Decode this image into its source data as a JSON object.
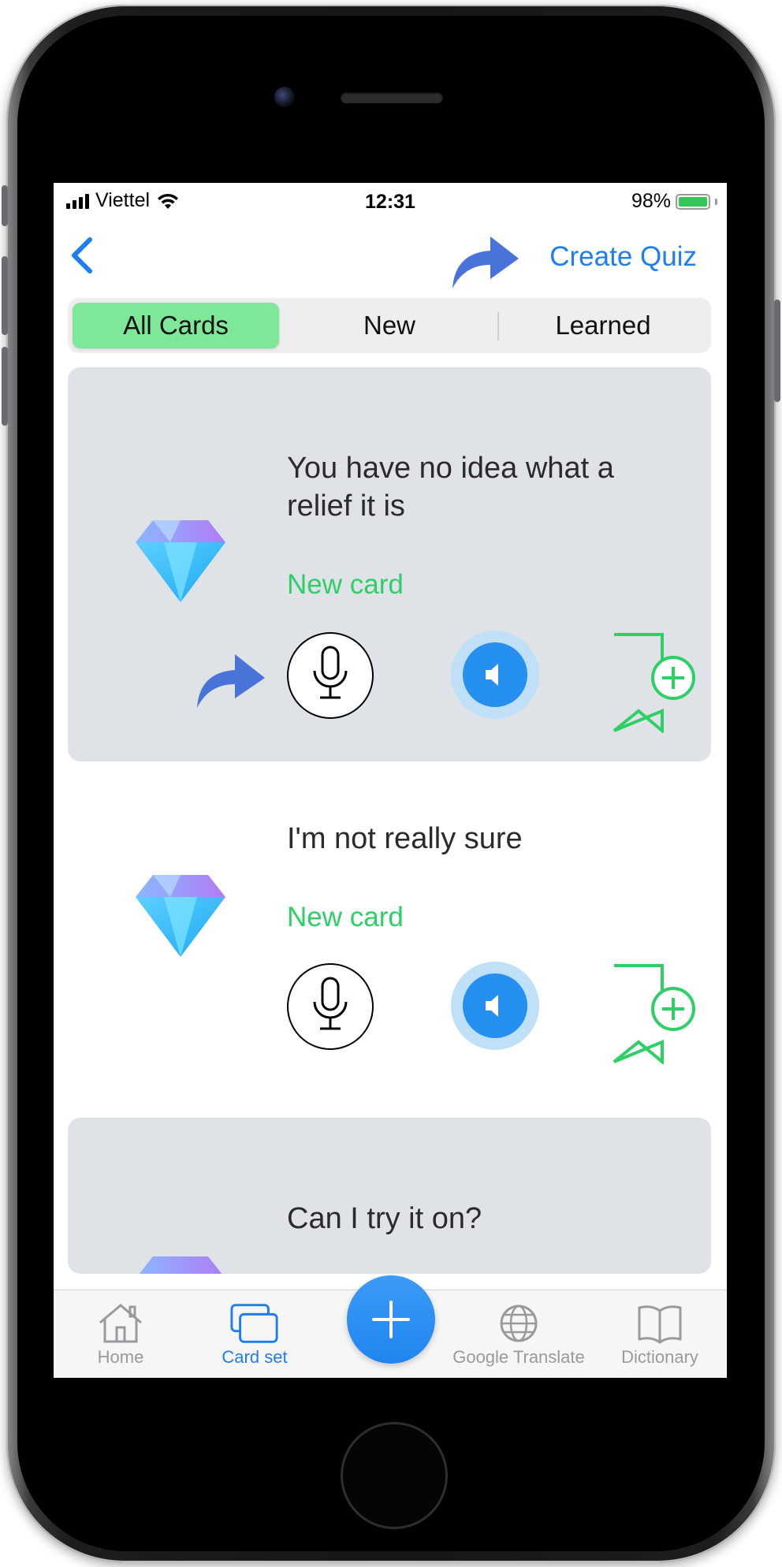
{
  "status_bar": {
    "carrier": "Viettel",
    "time": "12:31",
    "battery": "98%"
  },
  "nav": {
    "create_quiz_label": "Create Quiz"
  },
  "segments": [
    {
      "label": "All Cards",
      "active": true
    },
    {
      "label": "New",
      "active": false
    },
    {
      "label": "Learned",
      "active": false
    }
  ],
  "cards": [
    {
      "phrase": "You have no idea what a relief it is",
      "status": "New card"
    },
    {
      "phrase": "I'm not really sure",
      "status": "New card"
    },
    {
      "phrase": "Can I try it on?"
    }
  ],
  "tabbar": {
    "items": [
      {
        "label": "Home",
        "icon": "house-icon",
        "active": false
      },
      {
        "label": "Card set",
        "icon": "cards-icon",
        "active": true
      },
      {
        "label": "Google Translate",
        "icon": "globe-icon",
        "active": false
      },
      {
        "label": "Dictionary",
        "icon": "book-icon",
        "active": false
      }
    ],
    "fab_icon": "plus-icon"
  },
  "colors": {
    "accent_blue": "#1f7df0",
    "active_segment": "#7ee898",
    "new_card_green": "#2ecf66",
    "card_shade": "#dfe3e8",
    "speaker_blue": "#2590f0"
  }
}
